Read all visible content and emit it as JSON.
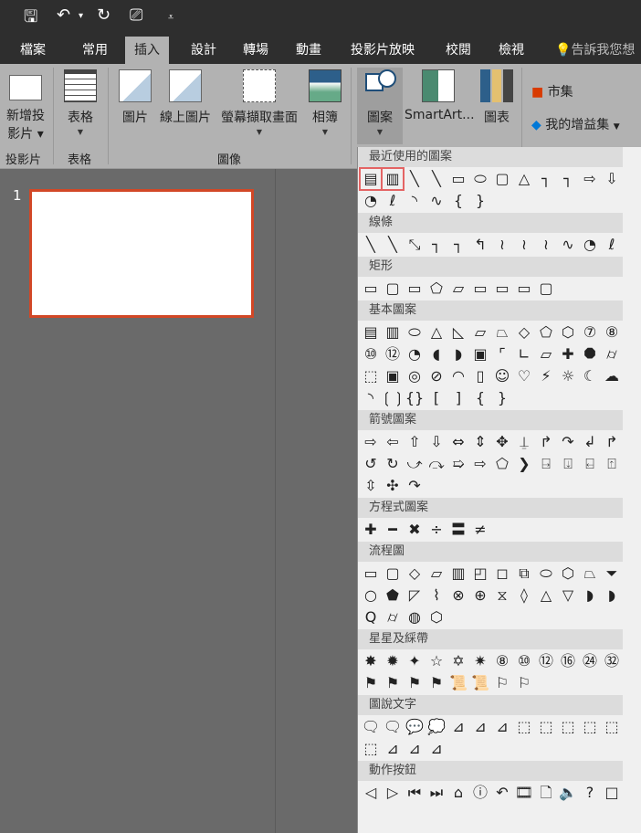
{
  "quick_access": {
    "save": "🖫",
    "undo": "↶",
    "undo_caret": "▾",
    "redo": "↻",
    "present": "⎚",
    "customize": "⩡"
  },
  "tabs": [
    "檔案",
    "常用",
    "插入",
    "設計",
    "轉場",
    "動畫",
    "投影片放映",
    "校閱",
    "檢視"
  ],
  "active_tab": "插入",
  "tell_me": "告訴我您想",
  "ribbon": {
    "new_slide": "新增投\n影片",
    "new_slide_line1": "新增投",
    "new_slide_line2": "影片 ▾",
    "table": "表格",
    "picture": "圖片",
    "online_picture": "線上圖片",
    "screenshot": "螢幕擷取畫面",
    "album": "相簿",
    "shapes": "圖案",
    "smartart": "SmartArt...",
    "chart": "圖表",
    "store": "市集",
    "my_addins": "我的增益集",
    "groups": {
      "slides": "投影片",
      "tables": "表格",
      "images": "圖像"
    }
  },
  "slide_number": "1",
  "shapes_panel": {
    "sections": [
      {
        "title": "最近使用的圖案",
        "shapes": [
          "▤",
          "▥",
          "╲",
          "╲",
          "▭",
          "⬭",
          "▢",
          "△",
          "┐",
          "┐",
          "⇨",
          "⇩",
          "◔",
          "ℓ",
          "◝",
          "∿",
          "{",
          "}"
        ]
      },
      {
        "title": "線條",
        "shapes": [
          "╲",
          "╲",
          "⤡",
          "┐",
          "┐",
          "↰",
          "≀",
          "≀",
          "≀",
          "∿",
          "◔",
          "ℓ"
        ]
      },
      {
        "title": "矩形",
        "shapes": [
          "▭",
          "▢",
          "▭",
          "⬠",
          "▱",
          "▭",
          "▭",
          "▭",
          "▢"
        ]
      },
      {
        "title": "基本圖案",
        "shapes": [
          "▤",
          "▥",
          "⬭",
          "△",
          "◺",
          "▱",
          "⏢",
          "◇",
          "⬠",
          "⬡",
          "⑦",
          "⑧",
          "⑩",
          "⑫",
          "◔",
          "◖",
          "◗",
          "▣",
          "⌜",
          "∟",
          "▱",
          "✚",
          "⯃",
          "⌭",
          "⬚",
          "▣",
          "◎",
          "⊘",
          "◠",
          "▯",
          "☺",
          "♡",
          "⚡",
          "☼",
          "☾",
          "☁",
          "◝",
          "❲❳",
          "{}",
          "[",
          "]",
          "{",
          "}"
        ]
      },
      {
        "title": "箭號圖案",
        "shapes": [
          "⇨",
          "⇦",
          "⇧",
          "⇩",
          "⇔",
          "⇕",
          "✥",
          "⍊",
          "↱",
          "↷",
          "↲",
          "↱",
          "↺",
          "↻",
          "⤻",
          "⤼",
          "➯",
          "⇨",
          "⬠",
          "❯",
          "⍈",
          "⍗",
          "⍇",
          "⍐",
          "⇳",
          "✣",
          "↷"
        ]
      },
      {
        "title": "方程式圖案",
        "shapes": [
          "✚",
          "━",
          "✖",
          "÷",
          "〓",
          "≠"
        ]
      },
      {
        "title": "流程圖",
        "shapes": [
          "▭",
          "▢",
          "◇",
          "▱",
          "▥",
          "◰",
          "◻",
          "⧉",
          "⬭",
          "⬡",
          "⏢",
          "⏷",
          "○",
          "⬟",
          "◸",
          "⌇",
          "⊗",
          "⊕",
          "⧖",
          "◊",
          "△",
          "▽",
          "◗",
          "◗",
          "Q",
          "⌭",
          "◍",
          "⬡"
        ]
      },
      {
        "title": "星星及綵帶",
        "shapes": [
          "✸",
          "✹",
          "✦",
          "☆",
          "✡",
          "✷",
          "⑧",
          "⑩",
          "⑫",
          "⑯",
          "㉔",
          "㉜",
          "⚑",
          "⚑",
          "⚑",
          "⚑",
          "📜",
          "📜",
          "⚐",
          "⚐"
        ]
      },
      {
        "title": "圖說文字",
        "shapes": [
          "🗨",
          "🗨",
          "💬",
          "💭",
          "⊿",
          "⊿",
          "⊿",
          "⬚",
          "⬚",
          "⬚",
          "⬚",
          "⬚",
          "⬚",
          "⊿",
          "⊿",
          "⊿"
        ]
      },
      {
        "title": "動作按鈕",
        "shapes": [
          "◁",
          "▷",
          "⏮",
          "⏭",
          "⌂",
          "ⓘ",
          "↶",
          "🎞",
          "🗋",
          "🔈",
          "?",
          "□"
        ]
      }
    ]
  }
}
